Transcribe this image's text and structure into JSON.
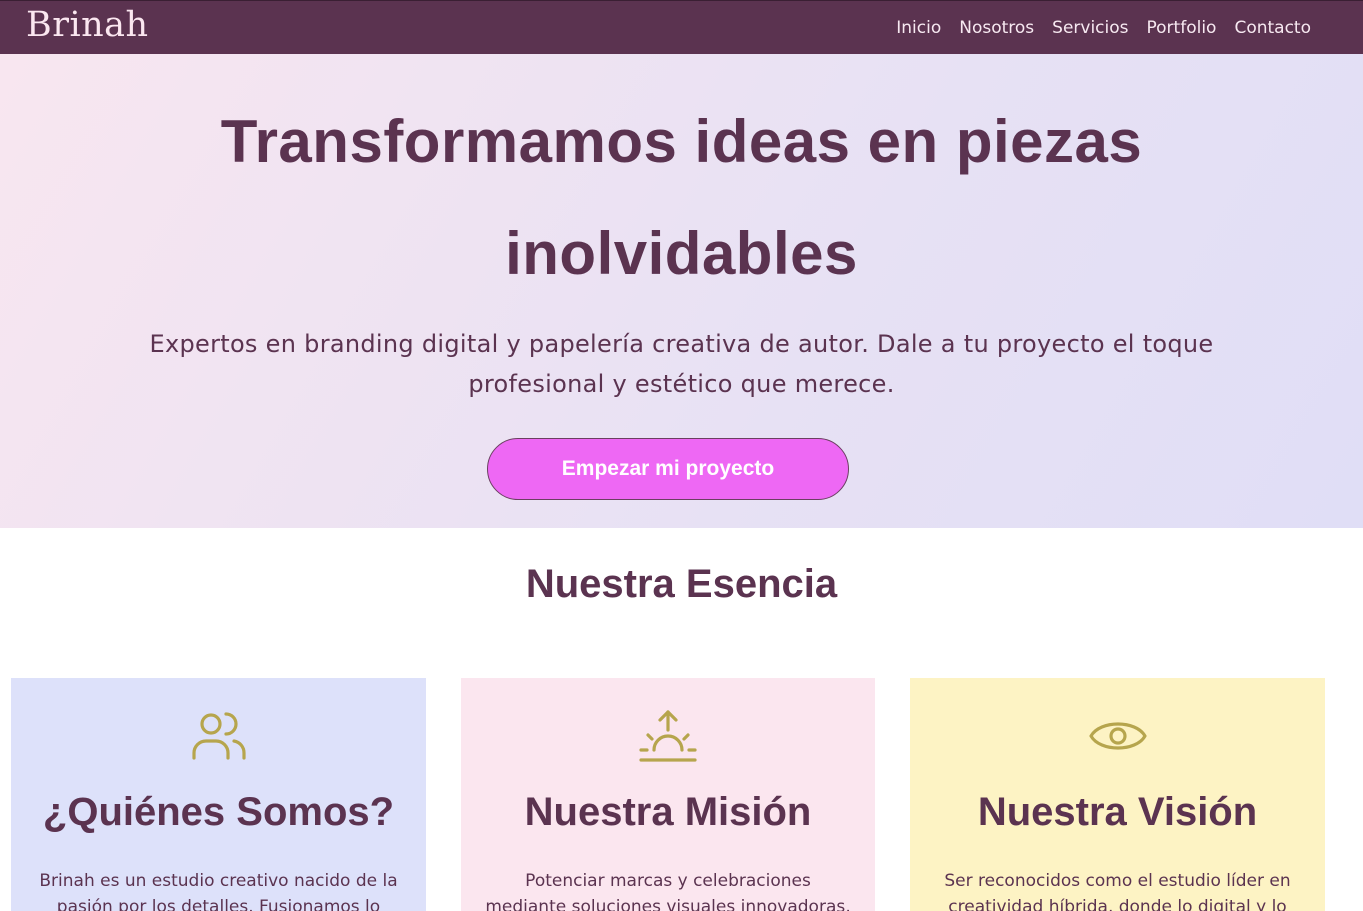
{
  "navbar": {
    "logo": "Brinah",
    "links": [
      "Inicio",
      "Nosotros",
      "Servicios",
      "Portfolio",
      "Contacto"
    ]
  },
  "hero": {
    "title": "Transformamos ideas en piezas inolvidables",
    "subtitle": "Expertos en branding digital y papelería creativa de autor. Dale a tu proyecto el toque profesional y estético que merece.",
    "cta_label": "Empezar mi proyecto"
  },
  "esencia": {
    "title": "Nuestra Esencia",
    "cards": [
      {
        "icon": "users-icon",
        "title": "¿Quiénes Somos?",
        "text": "Brinah es un estudio creativo nacido de la pasión por los detalles. Fusionamos lo"
      },
      {
        "icon": "sunrise-icon",
        "title": "Nuestra Misión",
        "text": "Potenciar marcas y celebraciones mediante soluciones visuales innovadoras, utilizando"
      },
      {
        "icon": "eye-icon",
        "title": "Nuestra Visión",
        "text": "Ser reconocidos como el estudio líder en creatividad híbrida, donde lo digital y lo"
      }
    ]
  },
  "colors": {
    "primary": "#5b3350",
    "accent": "#ee68f4",
    "icon": "#b6a54d",
    "card_blue": "#dde1fa",
    "card_pink": "#fbe6ef",
    "card_yellow": "#fdf3c4"
  }
}
